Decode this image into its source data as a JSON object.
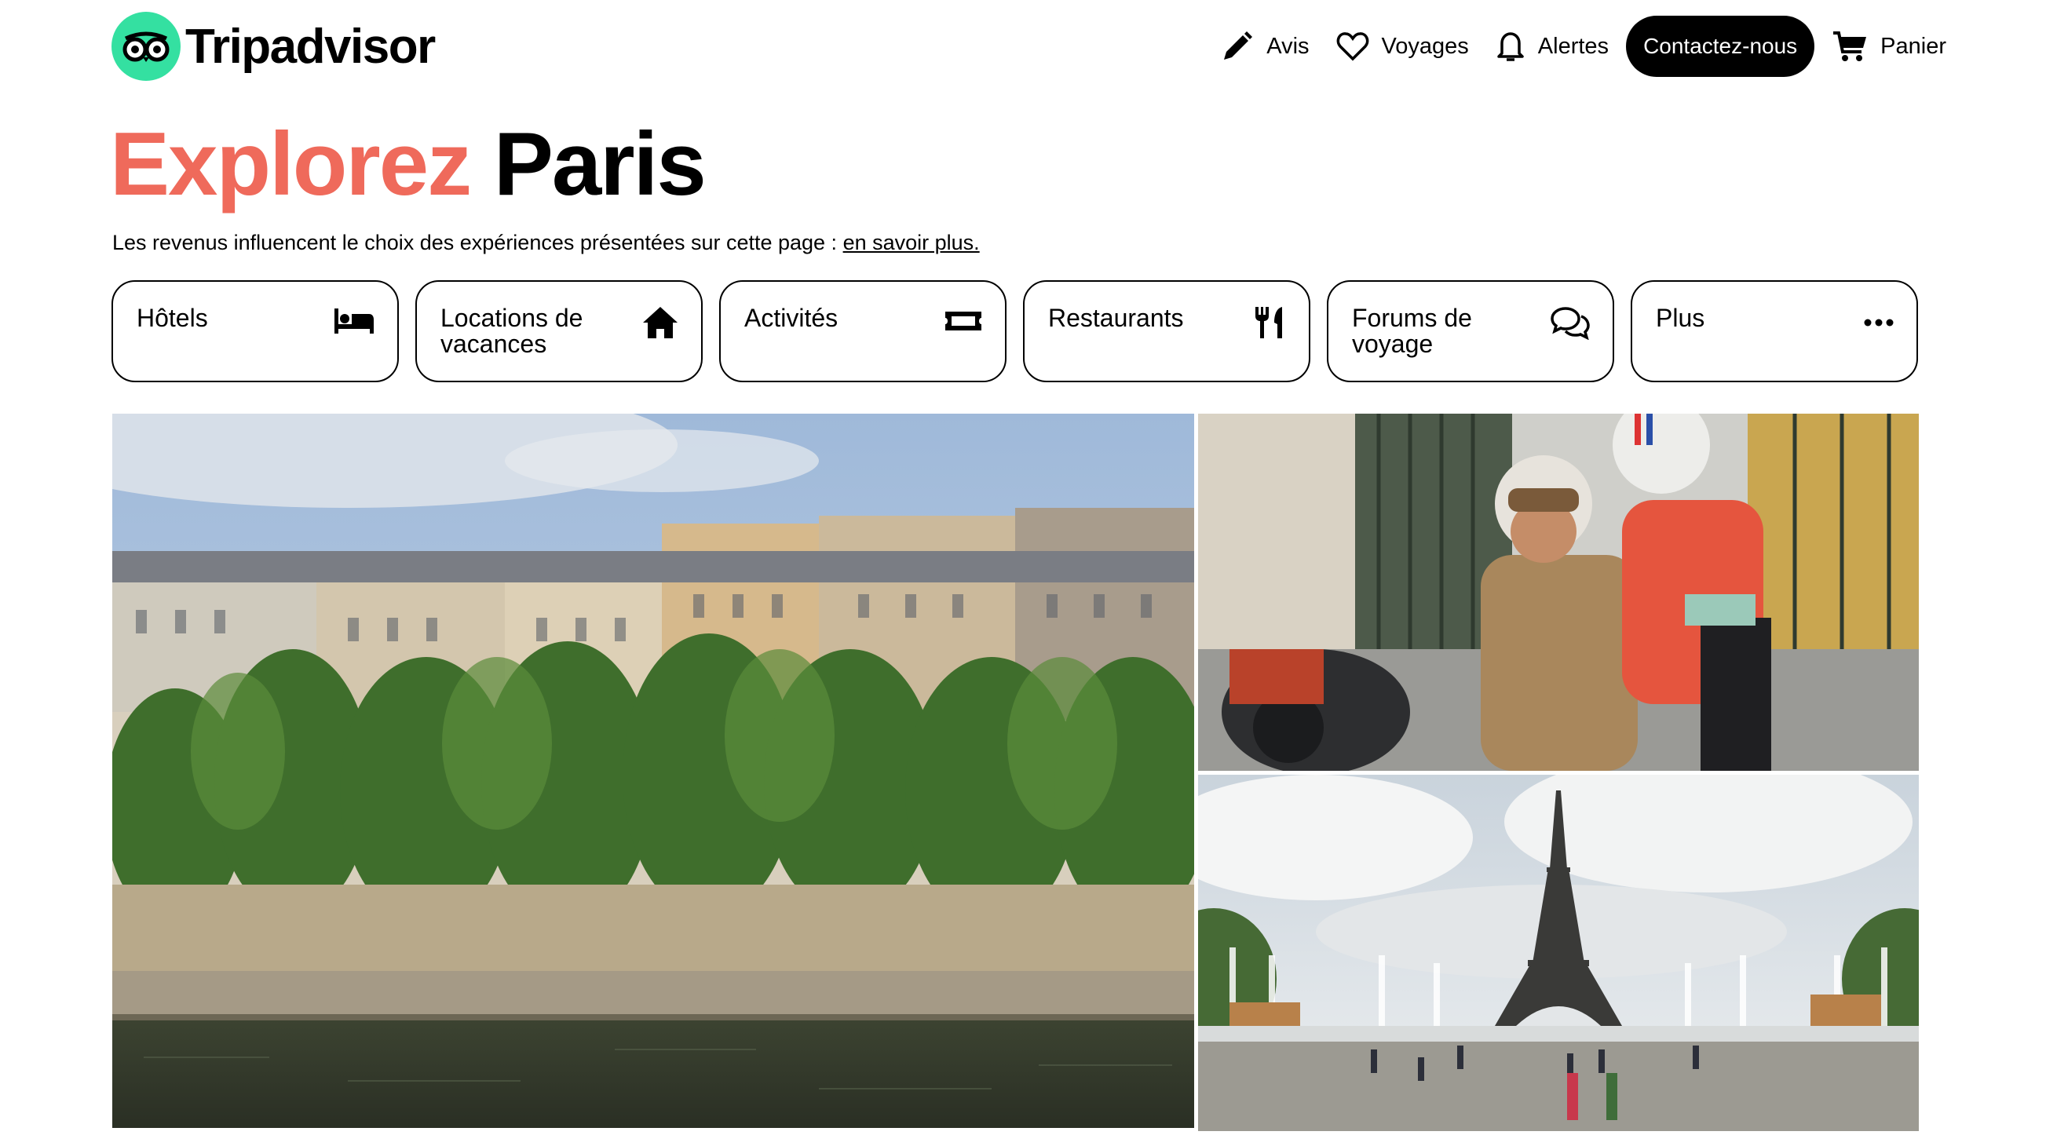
{
  "header": {
    "logo_text": "Tripadvisor",
    "nav": [
      {
        "label": "Avis",
        "icon": "pencil-icon"
      },
      {
        "label": "Voyages",
        "icon": "heart-icon"
      },
      {
        "label": "Alertes",
        "icon": "bell-icon"
      }
    ],
    "contact_label": "Contactez-nous",
    "cart_label": "Panier"
  },
  "hero": {
    "title_highlight": "Explorez",
    "title_city": "Paris",
    "disclaimer_text": "Les revenus influencent le choix des expériences présentées sur cette page :",
    "disclaimer_link": "en savoir plus."
  },
  "categories": [
    {
      "label": "Hôtels",
      "icon": "bed-icon"
    },
    {
      "label": "Locations de vacances",
      "icon": "house-icon"
    },
    {
      "label": "Activités",
      "icon": "ticket-icon"
    },
    {
      "label": "Restaurants",
      "icon": "fork-knife-icon"
    },
    {
      "label": "Forums de voyage",
      "icon": "chat-bubbles-icon"
    },
    {
      "label": "Plus",
      "icon": "more-dots-icon"
    }
  ],
  "colors": {
    "brand_green": "#34e0a1",
    "title_accent": "#ef6a5b",
    "button_dark": "#000000"
  }
}
